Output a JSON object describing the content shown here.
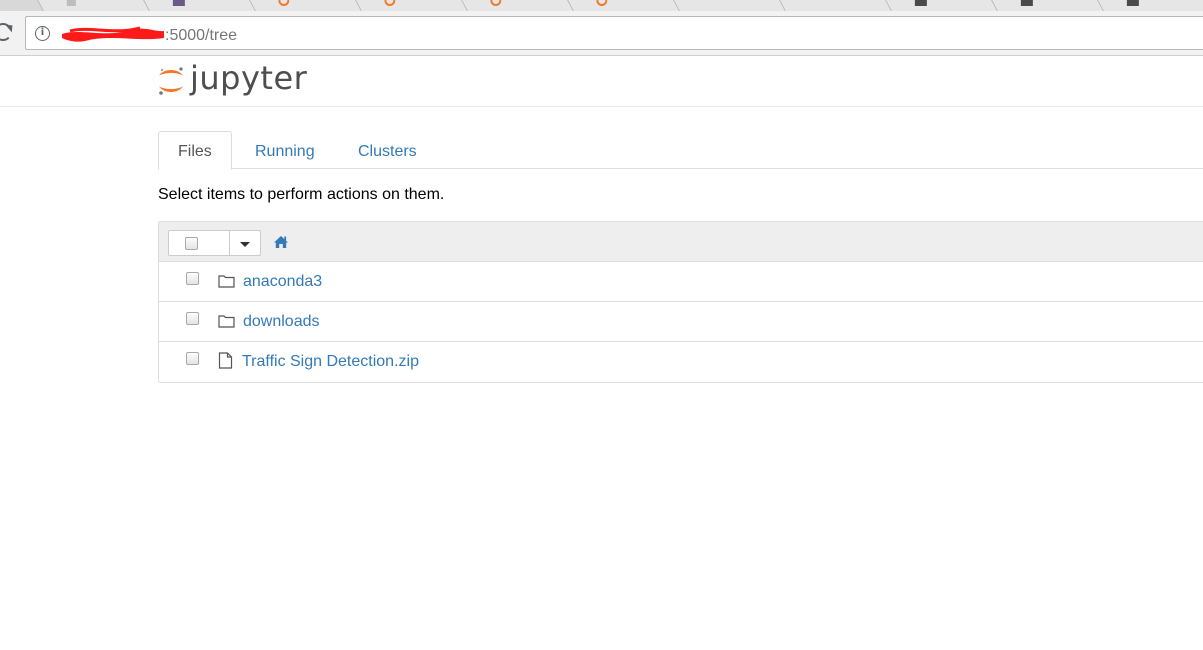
{
  "browser": {
    "address_bar": {
      "url_suffix": ":5000/tree"
    }
  },
  "jupyter": {
    "logo_text": "jupyter",
    "brand_color": "#f37726",
    "tabs": [
      {
        "label": "Files",
        "active": true
      },
      {
        "label": "Running",
        "active": false
      },
      {
        "label": "Clusters",
        "active": false
      }
    ],
    "hint_text": "Select items to perform actions on them.",
    "file_list": {
      "items": [
        {
          "name": "anaconda3",
          "type": "folder",
          "icon": "folder-icon"
        },
        {
          "name": "downloads",
          "type": "folder",
          "icon": "folder-icon"
        },
        {
          "name": "Traffic Sign Detection.zip",
          "type": "file",
          "icon": "file-icon"
        }
      ]
    },
    "link_color": "#337ab7"
  }
}
